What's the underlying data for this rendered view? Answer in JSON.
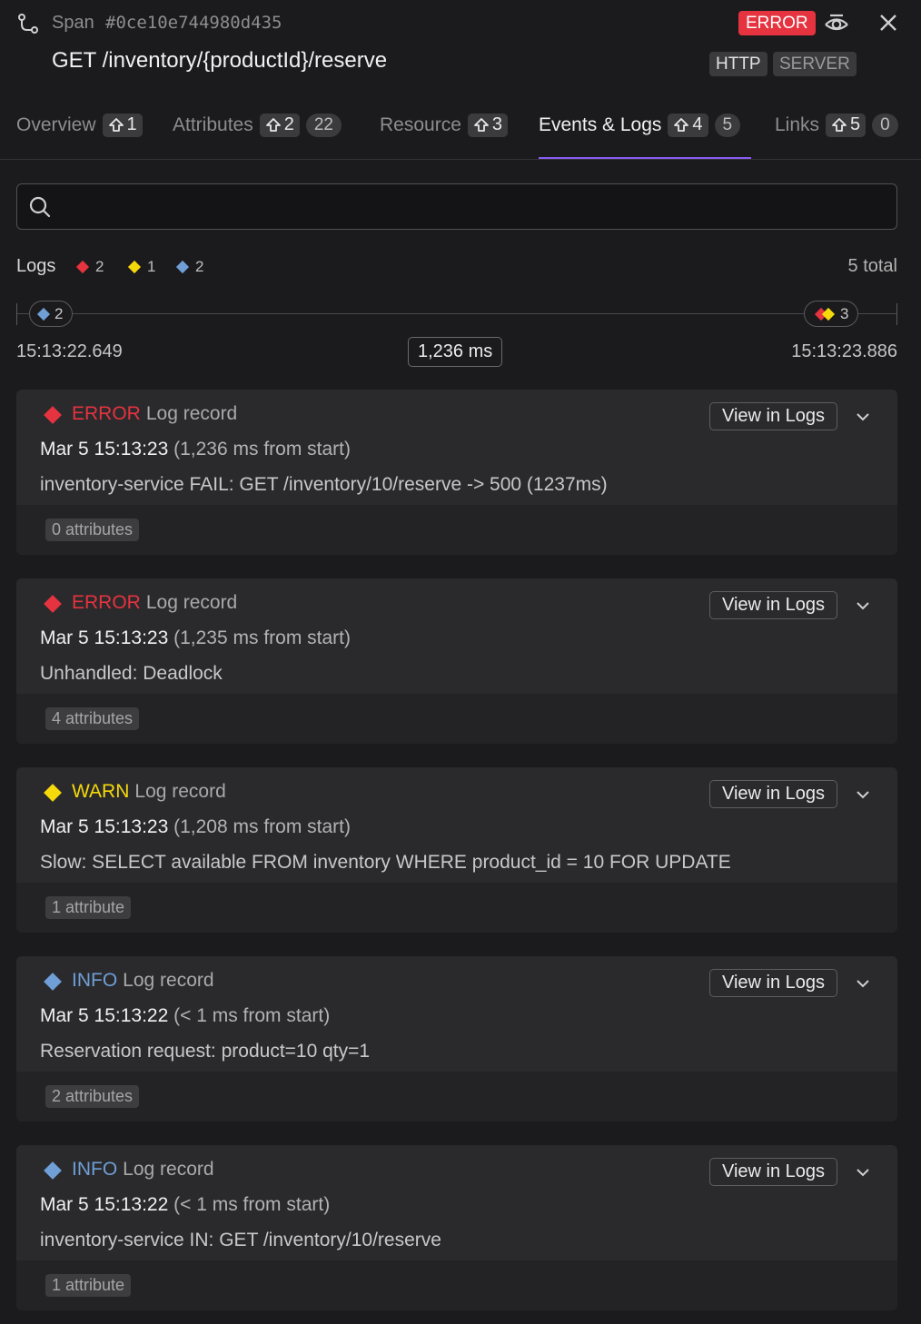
{
  "colors": {
    "error": "#e5333f",
    "warn": "#f5d90a",
    "info": "#6f9fd6",
    "accent": "#8b5cf6"
  },
  "header": {
    "span_label": "Span",
    "span_id": "#0ce10e744980d435",
    "status_badge": "ERROR",
    "title": "GET /inventory/{productId}/reserve",
    "tags": [
      "HTTP",
      "SERVER"
    ],
    "icons": {
      "span": "route-icon",
      "peek": "eye-icon",
      "close": "close-icon"
    }
  },
  "tabs": [
    {
      "label": "Overview",
      "shortcut": "1",
      "count": null,
      "active": false
    },
    {
      "label": "Attributes",
      "shortcut": "2",
      "count": "22",
      "active": false
    },
    {
      "label": "Resource",
      "shortcut": "3",
      "count": null,
      "active": false
    },
    {
      "label": "Events & Logs",
      "shortcut": "4",
      "count": "5",
      "active": true
    },
    {
      "label": "Links",
      "shortcut": "5",
      "count": "0",
      "active": false
    }
  ],
  "search": {
    "placeholder": "",
    "value": ""
  },
  "logs": {
    "label": "Logs",
    "error_count": "2",
    "warn_count": "1",
    "info_count": "2",
    "total": "5 total"
  },
  "timeline": {
    "start": "15:13:22.649",
    "end": "15:13:23.886",
    "duration": "1,236 ms",
    "start_group_count": "2",
    "end_group_count": "3"
  },
  "view_label": "View in Logs",
  "records": [
    {
      "level": "ERROR",
      "kind": "Log record",
      "time": "Mar 5 15:13:23",
      "relative": "(1,236 ms from start)",
      "message": "inventory-service FAIL: GET /inventory/10/reserve -> 500 (1237ms)",
      "attributes": "0 attributes"
    },
    {
      "level": "ERROR",
      "kind": "Log record",
      "time": "Mar 5 15:13:23",
      "relative": "(1,235 ms from start)",
      "message": "Unhandled: Deadlock",
      "attributes": "4 attributes"
    },
    {
      "level": "WARN",
      "kind": "Log record",
      "time": "Mar 5 15:13:23",
      "relative": "(1,208 ms from start)",
      "message": "Slow: SELECT available FROM inventory WHERE product_id = 10 FOR UPDATE",
      "attributes": "1 attribute"
    },
    {
      "level": "INFO",
      "kind": "Log record",
      "time": "Mar 5 15:13:22",
      "relative": "(< 1 ms from start)",
      "message": "Reservation request: product=10 qty=1",
      "attributes": "2 attributes"
    },
    {
      "level": "INFO",
      "kind": "Log record",
      "time": "Mar 5 15:13:22",
      "relative": "(< 1 ms from start)",
      "message": "inventory-service IN: GET /inventory/10/reserve",
      "attributes": "1 attribute"
    }
  ]
}
